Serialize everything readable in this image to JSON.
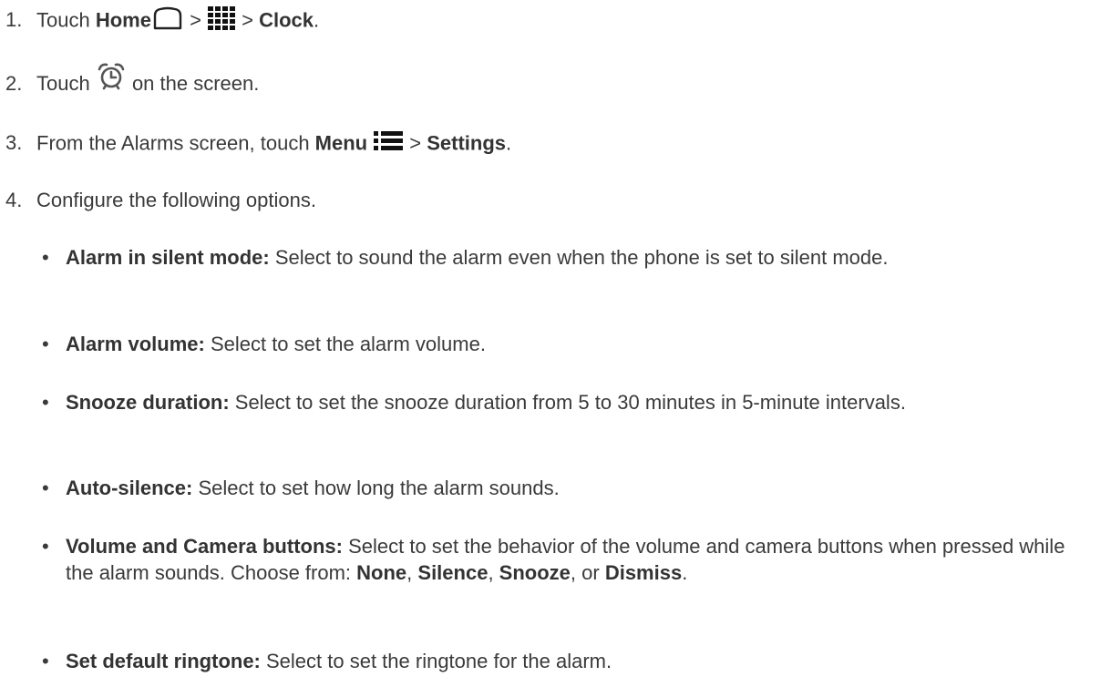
{
  "steps": [
    {
      "num": "1.",
      "pre": "Touch ",
      "home": "Home",
      "sep1": " > ",
      "sep2": " > ",
      "clock": "Clock",
      "end": "."
    },
    {
      "num": "2.",
      "pre": "Touch ",
      "post": " on the screen."
    },
    {
      "num": "3.",
      "pre": "From the Alarms screen, touch ",
      "menu": "Menu",
      "sep": " > ",
      "settings": "Settings",
      "end": "."
    },
    {
      "num": "4.",
      "text": "Configure the following options."
    }
  ],
  "options": [
    {
      "term": "Alarm in silent mode:",
      "desc": " Select to sound the alarm even when the phone is set to silent mode."
    },
    {
      "term": "Alarm volume:",
      "desc": " Select to set the alarm volume."
    },
    {
      "term": "Snooze duration:",
      "desc": " Select to set the snooze duration from 5 to 30 minutes in 5-minute intervals."
    },
    {
      "term": "Auto-silence:",
      "desc": " Select to set how long the alarm sounds."
    },
    {
      "term": "Volume and Camera buttons:",
      "desc": " Select to set the behavior of the volume and camera buttons when pressed while the alarm sounds. Choose from: ",
      "choices": [
        "None",
        "Silence",
        "Snooze",
        "Dismiss"
      ],
      "sep1": ", ",
      "sep2": ", ",
      "sep3": ", or ",
      "end": "."
    },
    {
      "term": "Set default ringtone:",
      "desc": " Select to set the ringtone for the alarm."
    }
  ],
  "bullet": "•",
  "icons": {
    "home": "home-outline-icon",
    "apps": "apps-grid-icon",
    "alarm": "alarm-clock-icon",
    "menu": "menu-list-icon"
  }
}
